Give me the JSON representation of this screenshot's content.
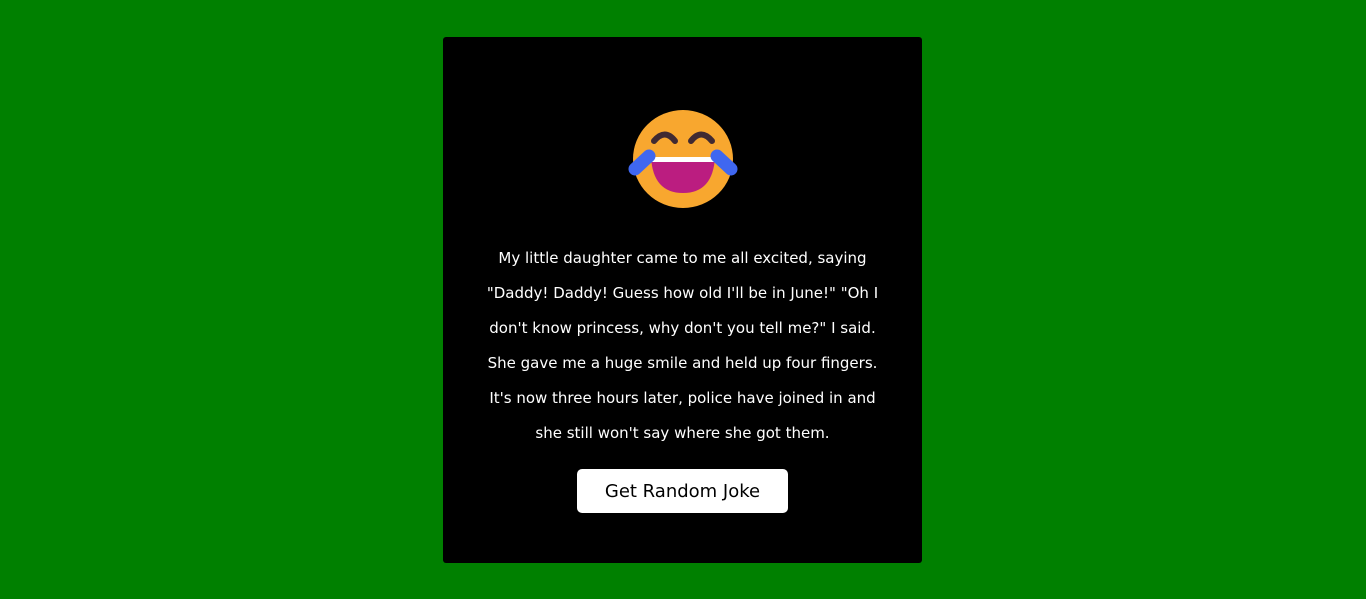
{
  "emoji": {
    "icon": "tears-of-joy-emoji-icon",
    "colors": {
      "face": "#F8A72F",
      "mouth": "#BB1D80",
      "teeth": "#FFFFFF",
      "tears": "#3F67F0",
      "eyes": "#402A32"
    }
  },
  "joke": {
    "text": "My little daughter came to me all excited, saying \"Daddy! Daddy! Guess how old I'll be in June!\" \"Oh I don't know princess, why don't you tell me?\" I said. She gave me a huge smile and held up four fingers. It's now three hours later, police have joined in and she still won't say where she got them."
  },
  "button": {
    "label": "Get Random Joke"
  },
  "colors": {
    "page_background": "#008000",
    "card_background": "#000000",
    "text": "#FFFFFF",
    "button_background": "#FFFFFF",
    "button_text": "#000000"
  }
}
